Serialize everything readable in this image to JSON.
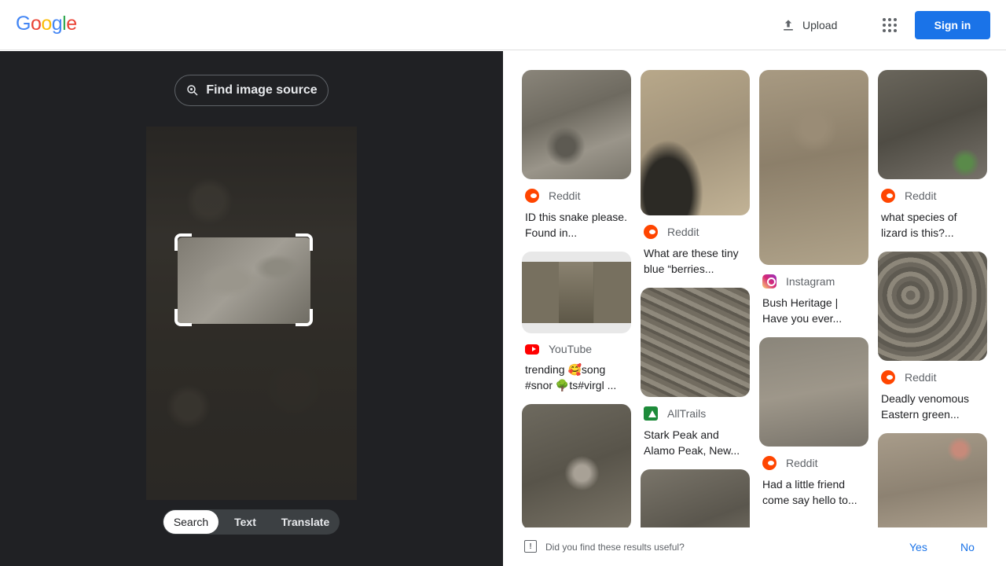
{
  "header": {
    "logo_letters": [
      "G",
      "o",
      "o",
      "g",
      "l",
      "e"
    ],
    "logo_colors": [
      "#4285f4",
      "#ea4335",
      "#fbbc05",
      "#4285f4",
      "#34a853",
      "#ea4335"
    ],
    "upload_label": "Upload",
    "signin_label": "Sign in"
  },
  "left_panel": {
    "find_source_label": "Find image source",
    "tabs": [
      {
        "label": "Search",
        "active": true
      },
      {
        "label": "Text",
        "active": false
      },
      {
        "label": "Translate",
        "active": false
      }
    ]
  },
  "results": {
    "col1": [
      {
        "source": "Reddit",
        "icon": "reddit-icon",
        "title": "ID this snake please. Found in..."
      },
      {
        "source": "YouTube",
        "icon": "youtube-icon",
        "title": "trending 🥰song #snor 🌳ts#virgl ..."
      },
      {
        "source": "",
        "icon": "",
        "title": ""
      }
    ],
    "col2": [
      {
        "source": "Reddit",
        "icon": "reddit-icon",
        "title": "What are these tiny blue “berries..."
      },
      {
        "source": "AllTrails",
        "icon": "alltrails-icon",
        "title": "Stark Peak and Alamo Peak, New..."
      },
      {
        "source": "",
        "icon": "",
        "title": ""
      }
    ],
    "col3": [
      {
        "source": "Instagram",
        "icon": "instagram-icon",
        "title": "Bush Heritage | Have you ever..."
      },
      {
        "source": "Reddit",
        "icon": "reddit-icon",
        "title": "Had a little friend come say hello to..."
      }
    ],
    "col4": [
      {
        "source": "Reddit",
        "icon": "reddit-icon",
        "title": "what species of lizard is this?..."
      },
      {
        "source": "Reddit",
        "icon": "reddit-icon",
        "title": "Deadly venomous Eastern green..."
      },
      {
        "source": "",
        "icon": "",
        "title": ""
      }
    ]
  },
  "footer": {
    "question": "Did you find these results useful?",
    "yes_label": "Yes",
    "no_label": "No"
  }
}
